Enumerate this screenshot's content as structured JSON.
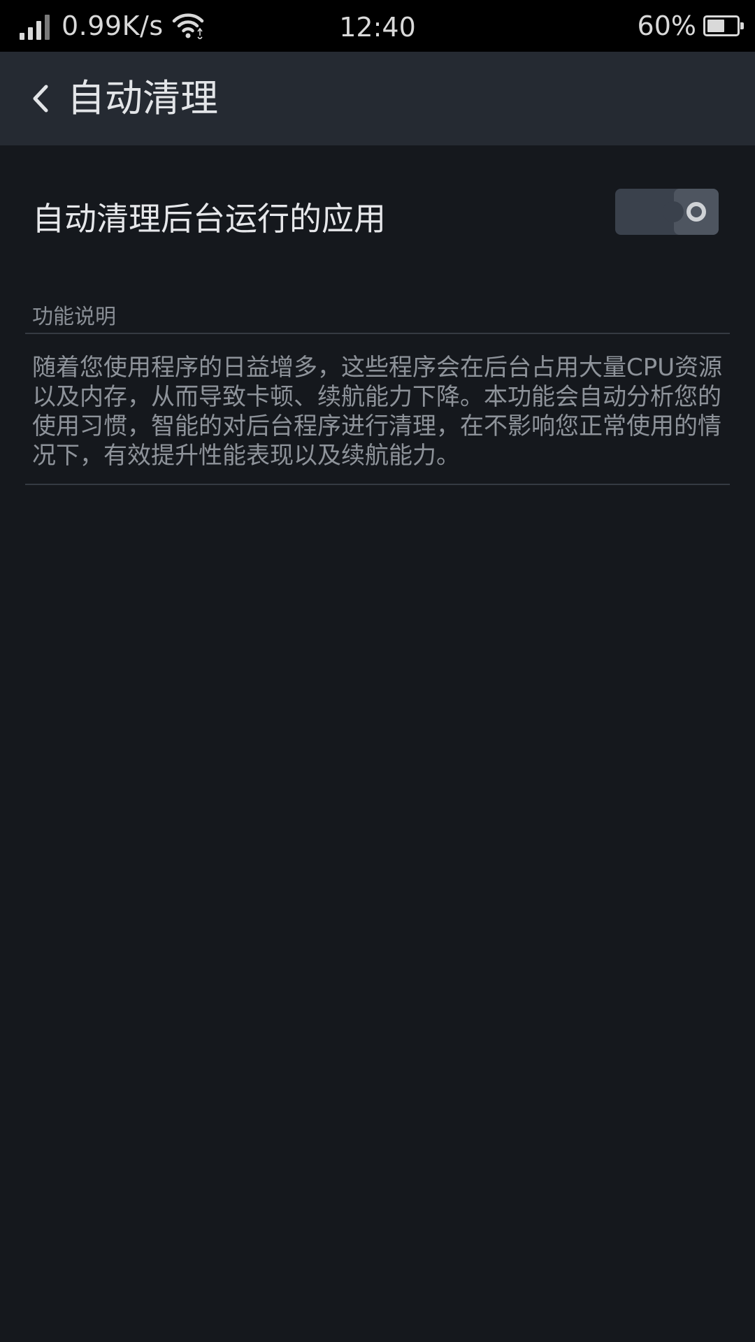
{
  "status_bar": {
    "net_speed": "0.99K/s",
    "time": "12:40",
    "battery_percent": "60%",
    "battery_level": 0.6,
    "icons": [
      "signal-icon",
      "wifi-icon",
      "battery-icon"
    ]
  },
  "action_bar": {
    "back_icon": "chevron-left-icon",
    "title": "自动清理"
  },
  "setting": {
    "label": "自动清理后台运行的应用",
    "enabled": false
  },
  "description_section": {
    "header": "功能说明",
    "text": "随着您使用程序的日益增多，这些程序会在后台占用大量CPU资源以及内存，从而导致卡顿、续航能力下降。本功能会自动分析您的使用习惯，智能的对后台程序进行清理，在不影响您正常使用的情况下，有效提升性能表现以及续航能力。"
  },
  "colors": {
    "background": "#15181d",
    "status_bar": "#000000",
    "action_bar": "#252a32",
    "primary_text": "#e6e7ea",
    "secondary_text": "#8e939a",
    "toggle_track": "#3a414c"
  }
}
